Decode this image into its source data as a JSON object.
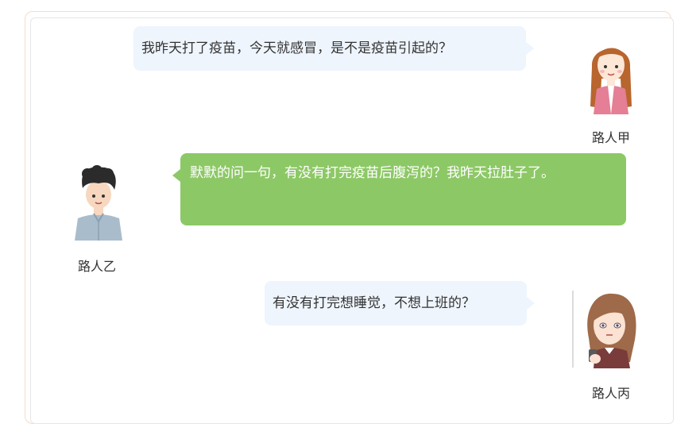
{
  "messages": [
    {
      "speaker": "路人甲",
      "text": "我昨天打了疫苗，今天就感冒，是不是疫苗引起的？"
    },
    {
      "speaker": "路人乙",
      "text": "默默的问一句，有没有打完疫苗后腹泻的？我昨天拉肚子了。"
    },
    {
      "speaker": "路人丙",
      "text": "有没有打完想睡觉，不想上班的？"
    }
  ],
  "colors": {
    "bubble_light": "#eef5fd",
    "bubble_green": "#8dc866",
    "frame_border": "#f5dcc8"
  }
}
